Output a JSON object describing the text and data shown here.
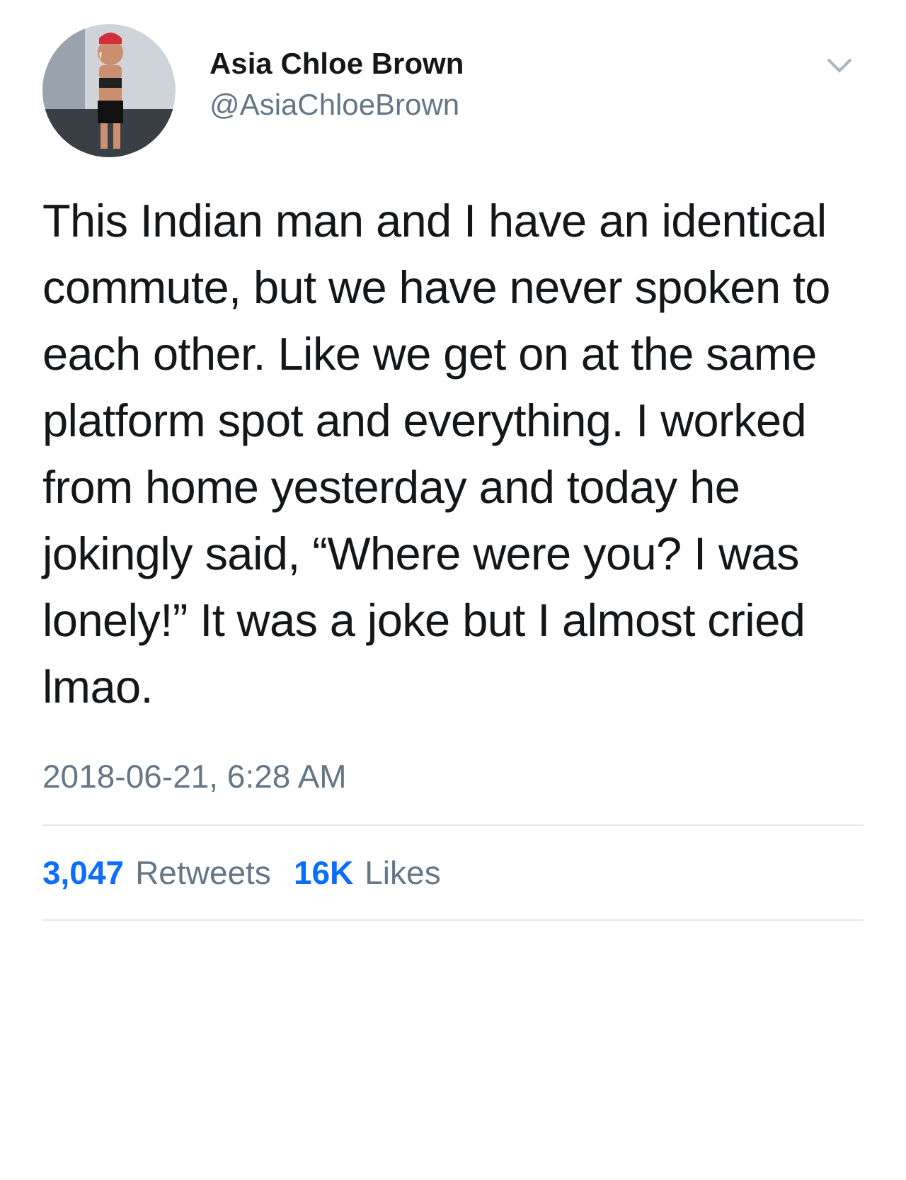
{
  "author": {
    "name": "Asia Chloe Brown",
    "handle": "@AsiaChloeBrown"
  },
  "tweet": {
    "text": "This Indian man and I have an identical commute, but we have never spoken to each other. Like we get on at the same platform spot and everything. I worked from home yesterday and today he jokingly said, “Where were you? I was lonely!” It was a joke but I almost cried lmao.",
    "timestamp": "2018-06-21, 6:28 AM"
  },
  "stats": [
    {
      "count": "3,047",
      "label": "Retweets"
    },
    {
      "count": "16K",
      "label": "Likes"
    }
  ]
}
